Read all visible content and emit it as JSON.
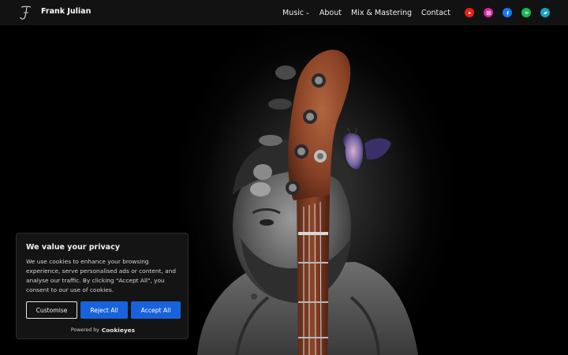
{
  "header": {
    "site_title": "Frank Julian",
    "logo_letter": "F",
    "nav": [
      {
        "label": "Music",
        "has_dropdown": true
      },
      {
        "label": "About"
      },
      {
        "label": "Mix & Mastering"
      },
      {
        "label": "Contact"
      }
    ],
    "socials": [
      {
        "name": "youtube-icon",
        "color": "#e62117"
      },
      {
        "name": "instagram-icon",
        "color": "#d6249f"
      },
      {
        "name": "facebook-icon",
        "color": "#1877f2"
      },
      {
        "name": "spotify-icon",
        "color": "#1db954"
      },
      {
        "name": "bandcamp-icon",
        "color": "#1da0c3"
      }
    ]
  },
  "cookie": {
    "title": "We value your privacy",
    "text": "We use cookies to enhance your browsing experience, serve personalised ads or content, and analyse our traffic. By clicking \"Accept All\", you consent to our use of cookies.",
    "customise_label": "Customise",
    "reject_label": "Reject All",
    "accept_label": "Accept All",
    "powered_by": "Powered by",
    "brand": "Cookieyes",
    "accent": "#1863dc"
  }
}
